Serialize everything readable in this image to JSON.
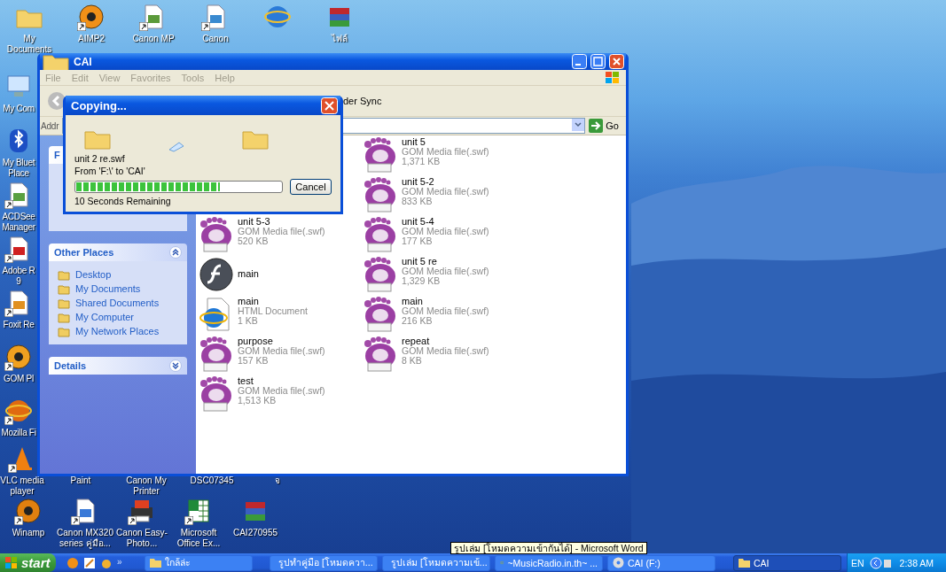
{
  "desktop_icons": {
    "top_row": [
      {
        "label": "My Documents",
        "shortcut": false
      },
      {
        "label": "AIMP2",
        "shortcut": true
      },
      {
        "label": "Canon MP",
        "shortcut": true
      },
      {
        "label": "Canon",
        "shortcut": true
      },
      {
        "shortcut": false
      },
      {
        "label": "ไฟล์",
        "shortcut": false
      }
    ],
    "left_column": [
      {
        "label": "My Com",
        "shortcut": false
      },
      {
        "label": "My Bluet\nPlace",
        "shortcut": false
      },
      {
        "label": "ACDSee\nManager",
        "shortcut": true
      },
      {
        "label": "Adobe R\n9",
        "shortcut": true
      },
      {
        "label": "Foxit Re",
        "shortcut": true
      },
      {
        "label": "GOM Pl",
        "shortcut": true
      },
      {
        "label": "Mozilla Fi",
        "shortcut": true
      }
    ],
    "middle_row": [
      {
        "kind": "icon",
        "label": "VLC media player",
        "shortcut": true
      },
      {
        "kind": "label",
        "label": "Paint"
      },
      {
        "kind": "label",
        "label": "Canon My Printer"
      },
      {
        "kind": "label",
        "label": "DSC07345"
      },
      {
        "kind": "label",
        "label": "จ"
      }
    ],
    "bottom_row": [
      {
        "label": "Winamp",
        "shortcut": true
      },
      {
        "label": "Canon MX320 series คู่มือ...",
        "shortcut": true
      },
      {
        "label": "Canon Easy-Photo...",
        "shortcut": true
      },
      {
        "label": "Microsoft Office Ex...",
        "shortcut": true
      },
      {
        "label": "CAI270955",
        "shortcut": false
      }
    ]
  },
  "explorer": {
    "title": "CAI",
    "menu": [
      "File",
      "Edit",
      "View",
      "Favorites",
      "Tools",
      "Help"
    ],
    "toolbar": {
      "button_label": "der Sync"
    },
    "address": {
      "label": "Addr",
      "go": "Go"
    },
    "left_panel": [
      {
        "title": "F"
      },
      {
        "title": "Other Places",
        "expanded": true,
        "items": [
          "Desktop",
          "My Documents",
          "Shared Documents",
          "My Computer",
          "My Network Places"
        ]
      },
      {
        "title": "Details",
        "expanded": false
      }
    ],
    "file_columns": [
      {
        "items": [
          {
            "kind": "swf",
            "name": "unit 5-3",
            "type": "GOM Media file(.swf)",
            "size": "520 KB"
          },
          {
            "kind": "flash",
            "name": "main"
          },
          {
            "kind": "html",
            "name": "main",
            "type": "HTML Document",
            "size": "1 KB"
          },
          {
            "kind": "swf",
            "name": "purpose",
            "type": "GOM Media file(.swf)",
            "size": "157 KB"
          },
          {
            "kind": "swf",
            "name": "test",
            "type": "GOM Media file(.swf)",
            "size": "1,513 KB"
          }
        ]
      },
      {
        "items": [
          {
            "kind": "swf",
            "name": "unit 5",
            "type": "GOM Media file(.swf)",
            "size": "1,371 KB"
          },
          {
            "kind": "swf",
            "name": "unit 5-2",
            "type": "GOM Media file(.swf)",
            "size": "833 KB"
          },
          {
            "kind": "swf",
            "name": "unit 5-4",
            "type": "GOM Media file(.swf)",
            "size": "177 KB"
          },
          {
            "kind": "swf",
            "name": "unit 5 re",
            "type": "GOM Media file(.swf)",
            "size": "1,329 KB"
          },
          {
            "kind": "swf",
            "name": "main",
            "type": "GOM Media file(.swf)",
            "size": "216 KB"
          },
          {
            "kind": "swf",
            "name": "repeat",
            "type": "GOM Media file(.swf)",
            "size": "8 KB"
          }
        ]
      }
    ]
  },
  "copy_dialog": {
    "title": "Copying...",
    "file": "unit 2 re.swf",
    "route": "From 'F:\\' to 'CAI'",
    "level": 0.7,
    "remaining": "10 Seconds Remaining",
    "cancel": "Cancel"
  },
  "taskbar": {
    "start": "start",
    "more": "»",
    "tasks": [
      {
        "label": "ใกล้ล่ะ",
        "selected": false
      },
      {
        "label": "รูปทำคู่มือ [โหมดควา...",
        "selected": false
      },
      {
        "label": "รูปเล่ม [โหมดความเข้...",
        "selected": false
      },
      {
        "label": "~MusicRadio.in.th~ ...",
        "selected": false
      },
      {
        "label": "CAI (F:)",
        "selected": false
      },
      {
        "label": "CAI",
        "selected": true
      }
    ],
    "language": "EN",
    "clock": "2:38 AM"
  },
  "tooltip": "รูปเล่ม [โหมดความเข้ากันได้] - Microsoft Word"
}
